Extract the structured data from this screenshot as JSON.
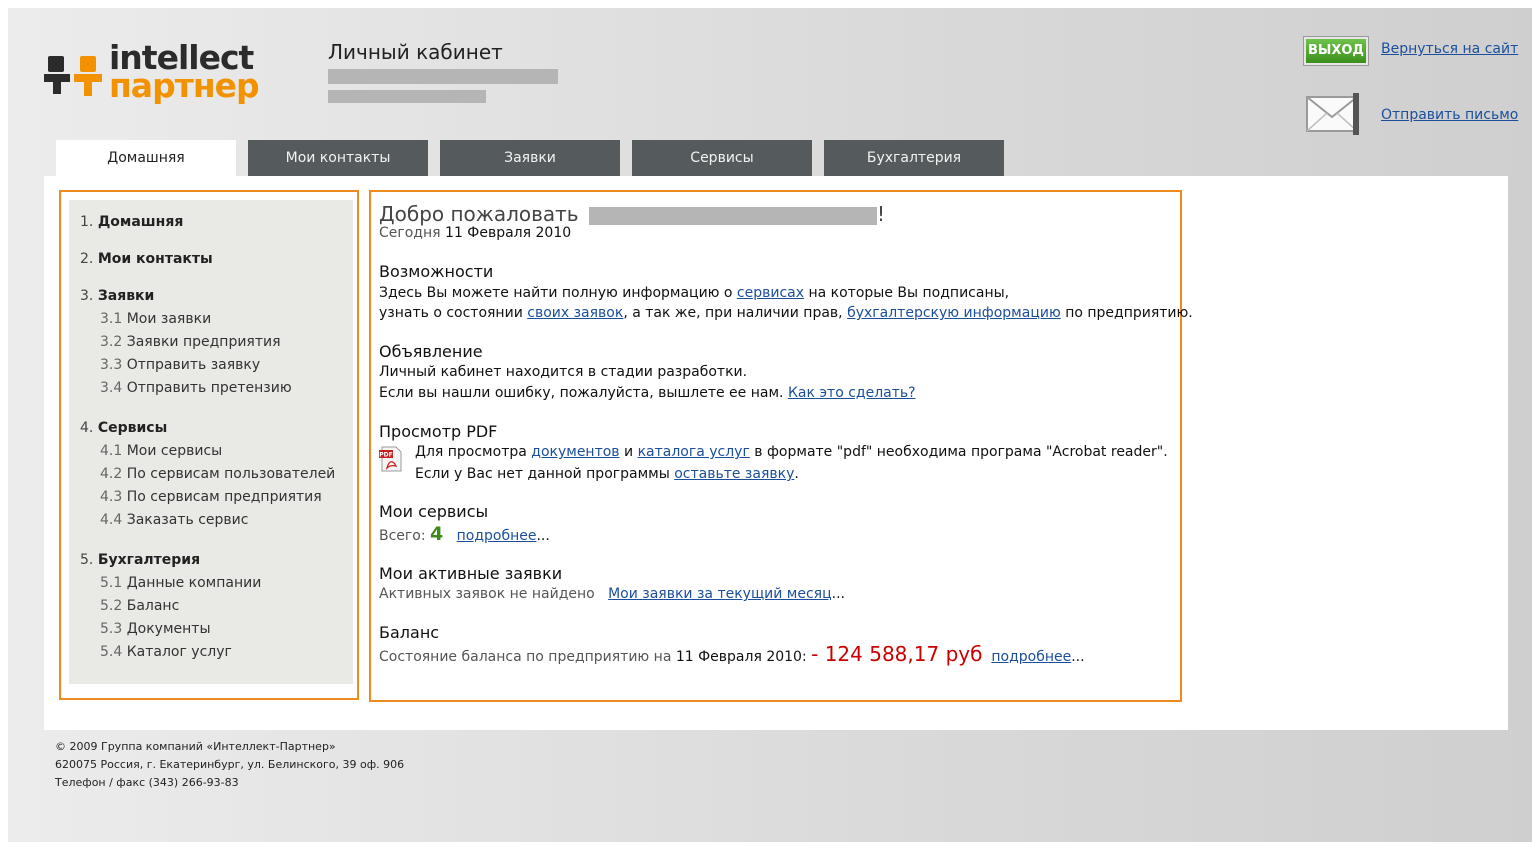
{
  "logo": {
    "line1": "intellect",
    "line2": "партнер"
  },
  "header": {
    "title": "Личный кабинет",
    "exit_label": "ВЫХОД",
    "back_link": "Вернуться на сайт",
    "send_mail_link": "Отправить письмо"
  },
  "tabs": [
    {
      "label": "Домашняя",
      "active": true
    },
    {
      "label": "Мои контакты"
    },
    {
      "label": "Заявки"
    },
    {
      "label": "Сервисы"
    },
    {
      "label": "Бухгалтерия"
    }
  ],
  "sidebar": {
    "sections": [
      {
        "num": "1.",
        "label": "Домашняя",
        "items": []
      },
      {
        "num": "2.",
        "label": "Мои контакты",
        "items": []
      },
      {
        "num": "3.",
        "label": "Заявки",
        "items": [
          {
            "num": "3.1",
            "label": "Мои заявки"
          },
          {
            "num": "3.2",
            "label": "Заявки предприятия"
          },
          {
            "num": "3.3",
            "label": "Отправить заявку"
          },
          {
            "num": "3.4",
            "label": "Отправить претензию"
          }
        ]
      },
      {
        "num": "4.",
        "label": "Сервисы",
        "items": [
          {
            "num": "4.1",
            "label": "Мои сервисы"
          },
          {
            "num": "4.2",
            "label": "По сервисам пользователей"
          },
          {
            "num": "4.3",
            "label": "По сервисам предприятия"
          },
          {
            "num": "4.4",
            "label": "Заказать сервис"
          }
        ]
      },
      {
        "num": "5.",
        "label": "Бухгалтерия",
        "items": [
          {
            "num": "5.1",
            "label": "Данные компании"
          },
          {
            "num": "5.2",
            "label": "Баланс"
          },
          {
            "num": "5.3",
            "label": "Документы"
          },
          {
            "num": "5.4",
            "label": "Каталог услуг"
          }
        ]
      }
    ]
  },
  "main": {
    "welcome": "Добро пожаловать",
    "welcome_end": "!",
    "today_label": "Сегодня",
    "today_date": "11 Февраля 2010",
    "features": {
      "title": "Возможности",
      "l1_a": "Здесь Вы можете найти полную информацию о ",
      "l1_link": "сервисах",
      "l1_b": " на которые Вы подписаны,",
      "l2_a": "узнать о состоянии ",
      "l2_link1": "своих заявок",
      "l2_b": ", а так же, при наличии прав, ",
      "l2_link2": "бухгалтерскую информацию",
      "l2_c": " по предприятию."
    },
    "announce": {
      "title": "Объявление",
      "l1": "Личный кабинет находится в стадии разработки.",
      "l2_a": "Если вы нашли ошибку, пожалуйста, вышлете ее нам. ",
      "l2_link": "Как это сделать?"
    },
    "pdf": {
      "title": "Просмотр PDF",
      "icon_text": "PDF",
      "l1_a": "Для просмотра ",
      "l1_link1": "документов",
      "l1_b": " и ",
      "l1_link2": "каталога услуг",
      "l1_c": " в формате \"pdf\" необходима програма \"Acrobat reader\".",
      "l2_a": "Если у Вас нет данной программы ",
      "l2_link": "оставьте заявку",
      "l2_b": "."
    },
    "services": {
      "title": "Мои сервисы",
      "total_label": "Всего:",
      "count": "4",
      "more": "подробнее",
      "ellipsis": "..."
    },
    "requests": {
      "title": "Мои активные заявки",
      "none": "Активных заявок не найдено",
      "link": "Мои заявки за текущий месяц",
      "ellipsis": "..."
    },
    "balance": {
      "title": "Баланс",
      "text": "Состояние баланса по предприятию на",
      "date": "11 Февраля 2010:",
      "amount": "- 124 588,17 руб",
      "more": "подробнее",
      "ellipsis": "..."
    }
  },
  "footer": {
    "line1": "© 2009 Группа компаний «Интеллект-Партнер»",
    "line2": "620075 Россия, г. Екатеринбург, ул. Белинского, 39 оф. 906",
    "line3": "Телефон / факс (343) 266-93-83"
  },
  "colors": {
    "accent_orange": "#ef8a1e",
    "tab_dark": "#555a5c",
    "link": "#1b4f9c",
    "balance_red": "#cc0000",
    "count_green": "#3d8a1a",
    "exit_green": "#4aa32a"
  }
}
